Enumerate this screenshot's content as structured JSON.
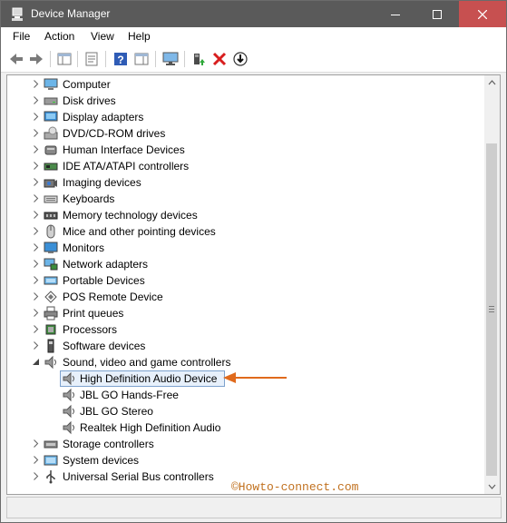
{
  "window": {
    "title": "Device Manager"
  },
  "menu": [
    "File",
    "Action",
    "View",
    "Help"
  ],
  "tree": {
    "categories": [
      {
        "label": "Computer",
        "icon": "computer-icon"
      },
      {
        "label": "Disk drives",
        "icon": "disk-drive-icon"
      },
      {
        "label": "Display adapters",
        "icon": "display-adapter-icon"
      },
      {
        "label": "DVD/CD-ROM drives",
        "icon": "dvd-drive-icon"
      },
      {
        "label": "Human Interface Devices",
        "icon": "hid-icon"
      },
      {
        "label": "IDE ATA/ATAPI controllers",
        "icon": "ide-controller-icon"
      },
      {
        "label": "Imaging devices",
        "icon": "camera-icon"
      },
      {
        "label": "Keyboards",
        "icon": "keyboard-icon"
      },
      {
        "label": "Memory technology devices",
        "icon": "memory-device-icon"
      },
      {
        "label": "Mice and other pointing devices",
        "icon": "mouse-icon"
      },
      {
        "label": "Monitors",
        "icon": "monitor-icon"
      },
      {
        "label": "Network adapters",
        "icon": "network-adapter-icon"
      },
      {
        "label": "Portable Devices",
        "icon": "portable-device-icon"
      },
      {
        "label": "POS Remote Device",
        "icon": "pos-device-icon"
      },
      {
        "label": "Print queues",
        "icon": "printer-icon"
      },
      {
        "label": "Processors",
        "icon": "processor-icon"
      },
      {
        "label": "Software devices",
        "icon": "software-device-icon"
      },
      {
        "label": "Sound, video and game controllers",
        "icon": "speaker-icon",
        "expanded": true,
        "children": [
          {
            "label": "High Definition Audio Device",
            "icon": "speaker-icon",
            "selected": true
          },
          {
            "label": "JBL GO Hands-Free",
            "icon": "speaker-icon"
          },
          {
            "label": "JBL GO Stereo",
            "icon": "speaker-icon"
          },
          {
            "label": "Realtek High Definition Audio",
            "icon": "speaker-icon"
          }
        ]
      },
      {
        "label": "Storage controllers",
        "icon": "storage-controller-icon"
      },
      {
        "label": "System devices",
        "icon": "system-device-icon"
      },
      {
        "label": "Universal Serial Bus controllers",
        "icon": "usb-icon"
      }
    ]
  },
  "watermark": "©Howto-connect.com",
  "colors": {
    "titlebar": "#5a5a5a",
    "close": "#c75050",
    "selection": "#e7f0fb",
    "arrow": "#e06a1c",
    "watermark": "#c1711f"
  }
}
